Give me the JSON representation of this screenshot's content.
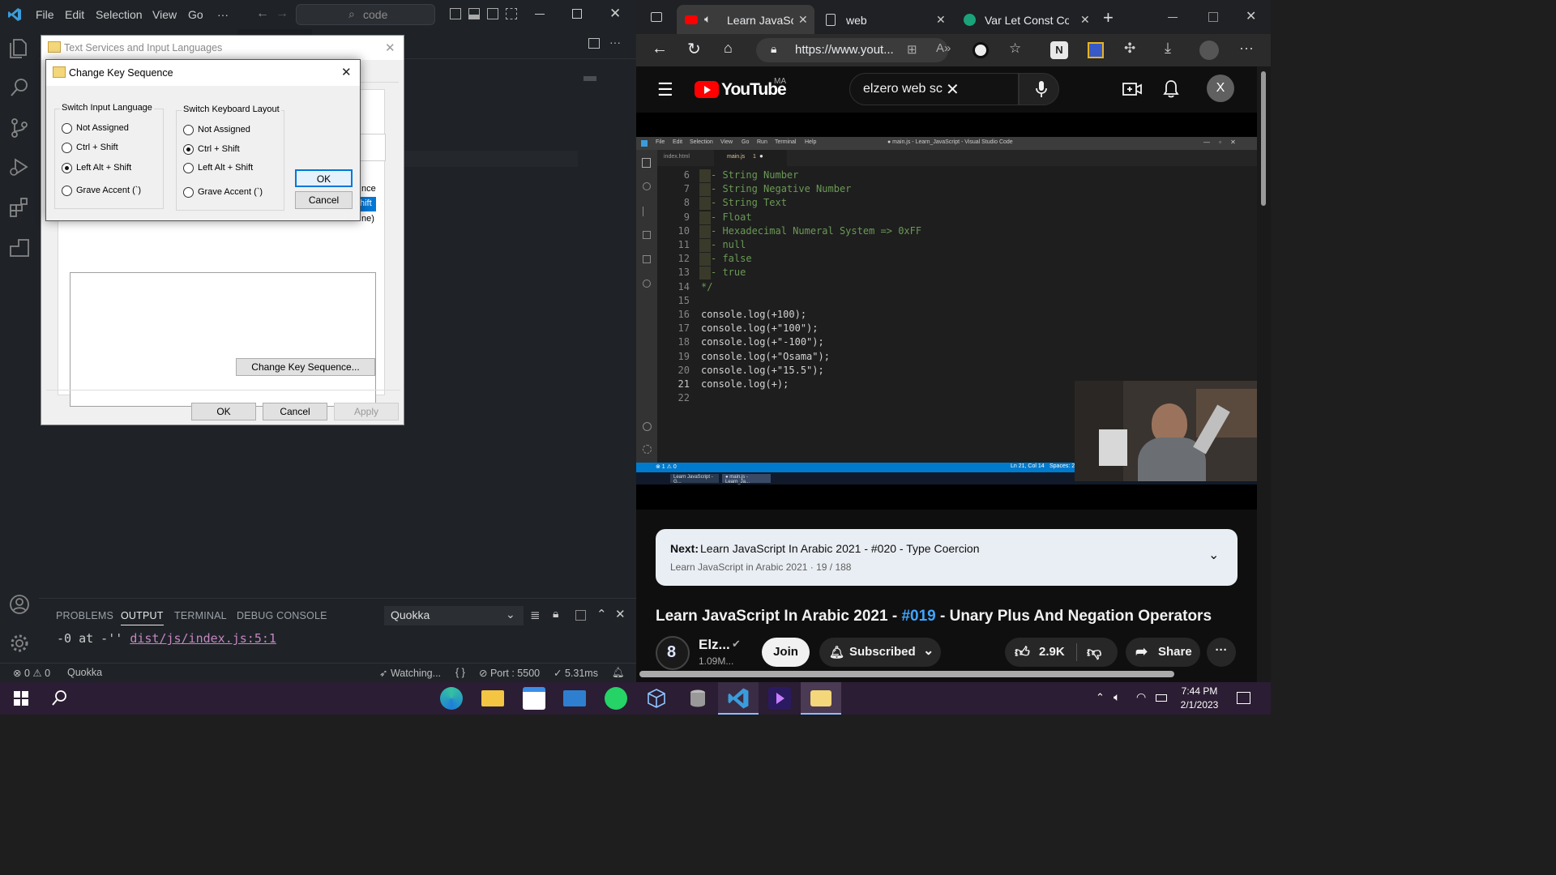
{
  "vscode": {
    "menu": [
      "File",
      "Edit",
      "Selection",
      "View",
      "Go",
      "···"
    ],
    "search_text": "code",
    "panel": {
      "tabs": [
        "PROBLEMS",
        "OUTPUT",
        "TERMINAL",
        "DEBUG CONSOLE"
      ],
      "active_tab": "OUTPUT",
      "output_channel": "Quokka",
      "output_prefix": "-0 at -'' ",
      "output_link": "dist/js/index.js:5:1"
    },
    "status": {
      "errors": "0",
      "warnings": "0",
      "quokka": "Quokka",
      "watching": "Watching...",
      "braces": "{ }",
      "port": "Port : 5500",
      "timing": "5.31ms"
    }
  },
  "dialog_text_services": {
    "title": "Text Services and Input Languages",
    "change_key_sequence_label": "Change Key Sequence...",
    "partial_text_1": "nce",
    "partial_text_2": "hift",
    "partial_text_3": "ne)",
    "ok": "OK",
    "cancel": "Cancel",
    "apply": "Apply"
  },
  "dialog_change_key": {
    "title": "Change Key Sequence",
    "input_group": {
      "title": "Switch Input Language",
      "options": [
        "Not Assigned",
        "Ctrl + Shift",
        "Left Alt + Shift",
        "Grave Accent (`)"
      ],
      "selected": 2
    },
    "layout_group": {
      "title": "Switch Keyboard Layout",
      "options": [
        "Not Assigned",
        "Ctrl + Shift",
        "Left Alt + Shift",
        "Grave Accent (`)"
      ],
      "selected": 1
    },
    "ok": "OK",
    "cancel": "Cancel"
  },
  "browser": {
    "tabs": [
      {
        "label": "Learn JavaScri",
        "active": true
      },
      {
        "label": "web",
        "active": false
      },
      {
        "label": "Var Let Const Comp",
        "active": false
      }
    ],
    "address": "https://www.yout...",
    "youtube": {
      "logo_text": "YouTube",
      "region": "MA",
      "search_query": "elzero web sc",
      "avatar_letter": "X",
      "next": {
        "prefix": "Next:",
        "title": "Learn JavaScript In Arabic 2021 - #020 - Type Coercion",
        "playlist": "Learn JavaScript in Arabic 2021 · 19 / 188"
      },
      "video_title_pre": "Learn JavaScript In Arabic 2021 - ",
      "video_title_tag": "#019",
      "video_title_post": " - Unary Plus And Negation Operators",
      "channel_name": "Elz...",
      "subscribers": "1.09M...",
      "join": "Join",
      "subscribed": "Subscribed",
      "likes": "2.9K",
      "share": "Share"
    },
    "embedded_vscode": {
      "menu": [
        "File",
        "Edit",
        "Selection",
        "View",
        "Go",
        "Run",
        "Terminal",
        "Help"
      ],
      "window_title": "● main.js - Learn_JavaScript - Visual Studio Code",
      "tab_inactive": "index.html",
      "tab_active": "main.js",
      "tab_active_badge": "1",
      "status_problems": "⊗ 1 ⚠ 0",
      "status_cursor": "Ln 21, Col 14",
      "status_spaces": "Spaces: 2",
      "taskbar_item_1": "Learn JavaScript - G...",
      "taskbar_item_2": "● main.js - Learn_Ja...",
      "code_lines": [
        {
          "n": "6",
          "text": "- String Number",
          "kind": "comment"
        },
        {
          "n": "7",
          "text": "- String Negative Number",
          "kind": "comment"
        },
        {
          "n": "8",
          "text": "- String Text",
          "kind": "comment"
        },
        {
          "n": "9",
          "text": "- Float",
          "kind": "comment"
        },
        {
          "n": "10",
          "text": "- Hexadecimal Numeral System => 0xFF",
          "kind": "comment"
        },
        {
          "n": "11",
          "text": "- null",
          "kind": "comment"
        },
        {
          "n": "12",
          "text": "- false",
          "kind": "comment"
        },
        {
          "n": "13",
          "text": "- true",
          "kind": "comment"
        },
        {
          "n": "14",
          "text": "*/",
          "kind": "comment-end"
        },
        {
          "n": "15",
          "text": "",
          "kind": "blank"
        },
        {
          "n": "16",
          "text": "console.log(+100);",
          "kind": "code"
        },
        {
          "n": "17",
          "text": "console.log(+\"100\");",
          "kind": "code"
        },
        {
          "n": "18",
          "text": "console.log(+\"-100\");",
          "kind": "code"
        },
        {
          "n": "19",
          "text": "console.log(+\"Osama\");",
          "kind": "code"
        },
        {
          "n": "20",
          "text": "console.log(+\"15.5\");",
          "kind": "code"
        },
        {
          "n": "21",
          "text": "console.log(+);",
          "kind": "code"
        },
        {
          "n": "22",
          "text": "",
          "kind": "blank"
        }
      ]
    }
  },
  "taskbar": {
    "time": "7:44 PM",
    "date": "2/1/2023"
  }
}
